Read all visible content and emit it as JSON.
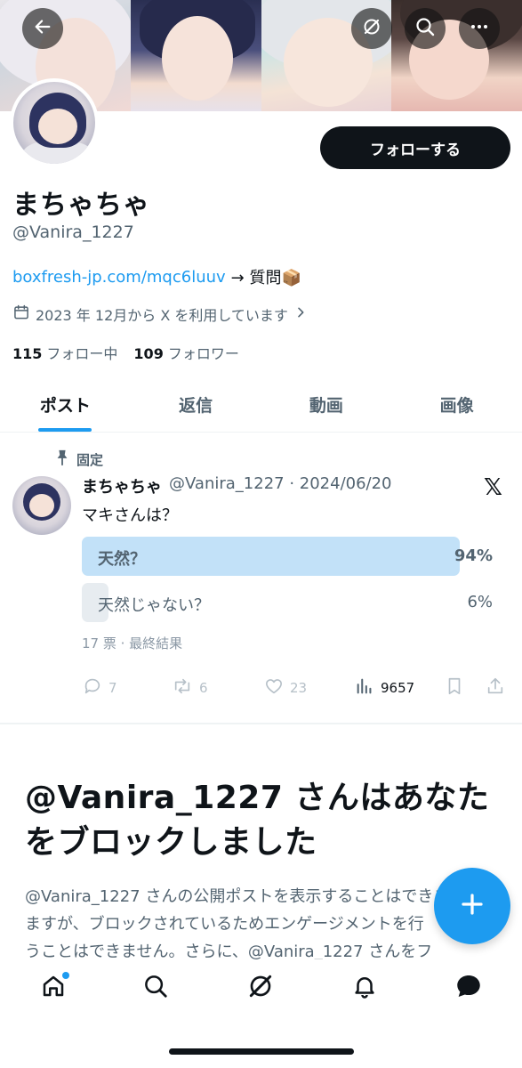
{
  "header": {
    "back_icon": "arrow-left-icon",
    "grok_icon": "grok-icon",
    "search_icon": "search-icon",
    "more_icon": "more-icon"
  },
  "profile": {
    "follow_label": "フォローする",
    "name": "まちゃちゃ",
    "handle": "@Vanira_1227",
    "bio_link": "boxfresh-jp.com/mqc6luuv",
    "bio_suffix": "→ 質問📦",
    "joined": "2023 年 12月から X を利用しています",
    "following_count": "115",
    "following_label": "フォロー中",
    "followers_count": "109",
    "followers_label": "フォロワー"
  },
  "tabs": [
    {
      "label": "ポスト",
      "active": true
    },
    {
      "label": "返信"
    },
    {
      "label": "動画"
    },
    {
      "label": "画像"
    }
  ],
  "post": {
    "pinned_label": "固定",
    "author_name": "まちゃちゃ",
    "author_meta": "@Vanira_1227 · 2024/06/20",
    "text": "マキさんは？",
    "poll": [
      {
        "label": "天然？",
        "percent_text": "94%",
        "percent": 94,
        "winner": true
      },
      {
        "label": "天然じゃない？",
        "percent_text": "6%",
        "percent": 6,
        "winner": false
      }
    ],
    "poll_meta": "17 票 · 最終結果",
    "replies": "7",
    "reposts": "6",
    "likes": "23",
    "views": "9657"
  },
  "blocked": {
    "title": "@Vanira_1227 さんはあなたをブロックしました",
    "desc_lines": [
      "@Vanira_1227 さんの公開ポストを表示することはできますが、",
      "ますが、ブロックされているためエンゲージメントを行",
      "うことはできません。さらに、@Vanira_1227 さんをフ"
    ]
  },
  "colors": {
    "accent": "#1d9bf0",
    "poll_win": "#c2e1f8",
    "poll_lose": "#e7ecf0"
  }
}
